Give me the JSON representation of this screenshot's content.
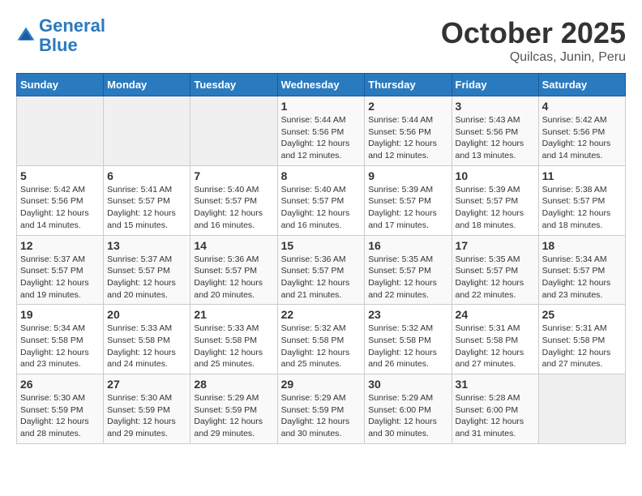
{
  "header": {
    "logo_line1": "General",
    "logo_line2": "Blue",
    "month_title": "October 2025",
    "subtitle": "Quilcas, Junin, Peru"
  },
  "weekdays": [
    "Sunday",
    "Monday",
    "Tuesday",
    "Wednesday",
    "Thursday",
    "Friday",
    "Saturday"
  ],
  "weeks": [
    [
      {
        "day": "",
        "info": ""
      },
      {
        "day": "",
        "info": ""
      },
      {
        "day": "",
        "info": ""
      },
      {
        "day": "1",
        "info": "Sunrise: 5:44 AM\nSunset: 5:56 PM\nDaylight: 12 hours\nand 12 minutes."
      },
      {
        "day": "2",
        "info": "Sunrise: 5:44 AM\nSunset: 5:56 PM\nDaylight: 12 hours\nand 12 minutes."
      },
      {
        "day": "3",
        "info": "Sunrise: 5:43 AM\nSunset: 5:56 PM\nDaylight: 12 hours\nand 13 minutes."
      },
      {
        "day": "4",
        "info": "Sunrise: 5:42 AM\nSunset: 5:56 PM\nDaylight: 12 hours\nand 14 minutes."
      }
    ],
    [
      {
        "day": "5",
        "info": "Sunrise: 5:42 AM\nSunset: 5:56 PM\nDaylight: 12 hours\nand 14 minutes."
      },
      {
        "day": "6",
        "info": "Sunrise: 5:41 AM\nSunset: 5:57 PM\nDaylight: 12 hours\nand 15 minutes."
      },
      {
        "day": "7",
        "info": "Sunrise: 5:40 AM\nSunset: 5:57 PM\nDaylight: 12 hours\nand 16 minutes."
      },
      {
        "day": "8",
        "info": "Sunrise: 5:40 AM\nSunset: 5:57 PM\nDaylight: 12 hours\nand 16 minutes."
      },
      {
        "day": "9",
        "info": "Sunrise: 5:39 AM\nSunset: 5:57 PM\nDaylight: 12 hours\nand 17 minutes."
      },
      {
        "day": "10",
        "info": "Sunrise: 5:39 AM\nSunset: 5:57 PM\nDaylight: 12 hours\nand 18 minutes."
      },
      {
        "day": "11",
        "info": "Sunrise: 5:38 AM\nSunset: 5:57 PM\nDaylight: 12 hours\nand 18 minutes."
      }
    ],
    [
      {
        "day": "12",
        "info": "Sunrise: 5:37 AM\nSunset: 5:57 PM\nDaylight: 12 hours\nand 19 minutes."
      },
      {
        "day": "13",
        "info": "Sunrise: 5:37 AM\nSunset: 5:57 PM\nDaylight: 12 hours\nand 20 minutes."
      },
      {
        "day": "14",
        "info": "Sunrise: 5:36 AM\nSunset: 5:57 PM\nDaylight: 12 hours\nand 20 minutes."
      },
      {
        "day": "15",
        "info": "Sunrise: 5:36 AM\nSunset: 5:57 PM\nDaylight: 12 hours\nand 21 minutes."
      },
      {
        "day": "16",
        "info": "Sunrise: 5:35 AM\nSunset: 5:57 PM\nDaylight: 12 hours\nand 22 minutes."
      },
      {
        "day": "17",
        "info": "Sunrise: 5:35 AM\nSunset: 5:57 PM\nDaylight: 12 hours\nand 22 minutes."
      },
      {
        "day": "18",
        "info": "Sunrise: 5:34 AM\nSunset: 5:57 PM\nDaylight: 12 hours\nand 23 minutes."
      }
    ],
    [
      {
        "day": "19",
        "info": "Sunrise: 5:34 AM\nSunset: 5:58 PM\nDaylight: 12 hours\nand 23 minutes."
      },
      {
        "day": "20",
        "info": "Sunrise: 5:33 AM\nSunset: 5:58 PM\nDaylight: 12 hours\nand 24 minutes."
      },
      {
        "day": "21",
        "info": "Sunrise: 5:33 AM\nSunset: 5:58 PM\nDaylight: 12 hours\nand 25 minutes."
      },
      {
        "day": "22",
        "info": "Sunrise: 5:32 AM\nSunset: 5:58 PM\nDaylight: 12 hours\nand 25 minutes."
      },
      {
        "day": "23",
        "info": "Sunrise: 5:32 AM\nSunset: 5:58 PM\nDaylight: 12 hours\nand 26 minutes."
      },
      {
        "day": "24",
        "info": "Sunrise: 5:31 AM\nSunset: 5:58 PM\nDaylight: 12 hours\nand 27 minutes."
      },
      {
        "day": "25",
        "info": "Sunrise: 5:31 AM\nSunset: 5:58 PM\nDaylight: 12 hours\nand 27 minutes."
      }
    ],
    [
      {
        "day": "26",
        "info": "Sunrise: 5:30 AM\nSunset: 5:59 PM\nDaylight: 12 hours\nand 28 minutes."
      },
      {
        "day": "27",
        "info": "Sunrise: 5:30 AM\nSunset: 5:59 PM\nDaylight: 12 hours\nand 29 minutes."
      },
      {
        "day": "28",
        "info": "Sunrise: 5:29 AM\nSunset: 5:59 PM\nDaylight: 12 hours\nand 29 minutes."
      },
      {
        "day": "29",
        "info": "Sunrise: 5:29 AM\nSunset: 5:59 PM\nDaylight: 12 hours\nand 30 minutes."
      },
      {
        "day": "30",
        "info": "Sunrise: 5:29 AM\nSunset: 6:00 PM\nDaylight: 12 hours\nand 30 minutes."
      },
      {
        "day": "31",
        "info": "Sunrise: 5:28 AM\nSunset: 6:00 PM\nDaylight: 12 hours\nand 31 minutes."
      },
      {
        "day": "",
        "info": ""
      }
    ]
  ]
}
